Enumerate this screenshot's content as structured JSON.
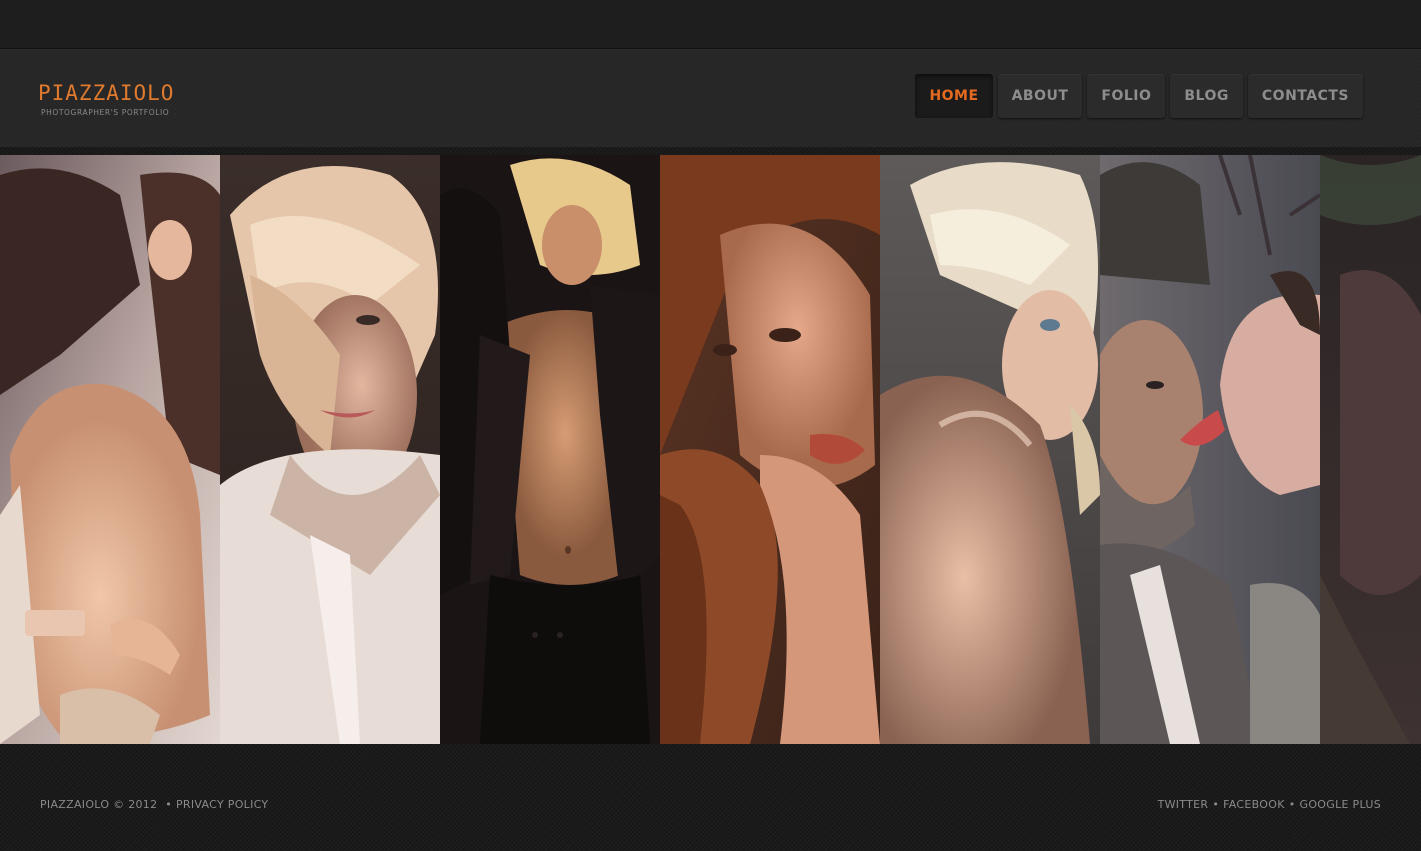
{
  "header": {
    "logo_title": "PIAZZAIOLO",
    "logo_subtitle": "PHOTOGRAPHER'S PORTFOLIO",
    "accent_color": "#e56a20"
  },
  "nav": {
    "items": [
      {
        "label": "HOME",
        "active": true
      },
      {
        "label": "ABOUT",
        "active": false
      },
      {
        "label": "FOLIO",
        "active": false
      },
      {
        "label": "BLOG",
        "active": false
      },
      {
        "label": "CONTACTS",
        "active": false
      }
    ]
  },
  "gallery": {
    "panels": [
      {
        "subject": "couple-embrace-photo",
        "tone": "#c9a690"
      },
      {
        "subject": "blonde-woman-portrait-photo",
        "tone": "#b08a74"
      },
      {
        "subject": "blonde-woman-black-jacket-photo",
        "tone": "#3a2a22"
      },
      {
        "subject": "auburn-hair-woman-portrait-photo",
        "tone": "#8a4a2c"
      },
      {
        "subject": "blonde-woman-shoulder-photo",
        "tone": "#6a625e"
      },
      {
        "subject": "couple-man-woman-photo",
        "tone": "#5a5554"
      },
      {
        "subject": "dark-partial-photo",
        "tone": "#2a2424"
      }
    ]
  },
  "footer": {
    "brand": "PIAZZAIOLO",
    "copyright": "© 2012",
    "bullet": "•",
    "privacy": "PRIVACY POLICY",
    "social": [
      "TWITTER",
      "FACEBOOK",
      "GOOGLE PLUS"
    ]
  }
}
